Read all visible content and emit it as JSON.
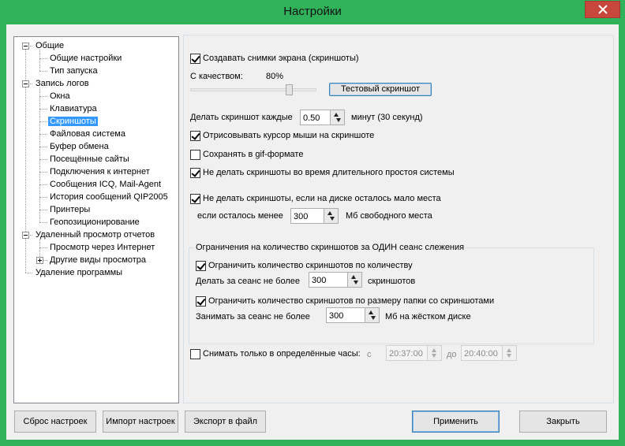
{
  "window": {
    "title": "Настройки"
  },
  "tree": {
    "items": [
      {
        "label": "Общие",
        "level": 0,
        "expander": "minus"
      },
      {
        "label": "Общие настройки",
        "level": 1
      },
      {
        "label": "Тип запуска",
        "level": 1
      },
      {
        "label": "Запись логов",
        "level": 0,
        "expander": "minus"
      },
      {
        "label": "Окна",
        "level": 1
      },
      {
        "label": "Клавиатура",
        "level": 1
      },
      {
        "label": "Скриншоты",
        "level": 1,
        "selected": true
      },
      {
        "label": "Файловая система",
        "level": 1
      },
      {
        "label": "Буфер обмена",
        "level": 1
      },
      {
        "label": "Посещённые сайты",
        "level": 1
      },
      {
        "label": "Подключения к интернет",
        "level": 1
      },
      {
        "label": "Сообщения ICQ, Mail-Agent",
        "level": 1
      },
      {
        "label": "История сообщений QIP2005",
        "level": 1
      },
      {
        "label": "Принтеры",
        "level": 1
      },
      {
        "label": "Геопозиционирование",
        "level": 1
      },
      {
        "label": "Удаленный просмотр отчетов",
        "level": 0,
        "expander": "minus"
      },
      {
        "label": "Просмотр через Интернет",
        "level": 1
      },
      {
        "label": "Другие виды просмотра",
        "level": 1,
        "expander": "plus"
      },
      {
        "label": "Удаление программы",
        "level": 0
      }
    ]
  },
  "screenshots": {
    "create_label": "Создавать снимки экрана (скриншоты)",
    "create_checked": true,
    "quality_label": "С качеством:",
    "quality_value": "80%",
    "quality_level": 0.8,
    "test_button": "Тестовый скриншот",
    "interval_label": "Делать скриншот каждые",
    "interval_value": "0.50",
    "interval_unit": "минут (30 секунд)",
    "draw_cursor_label": "Отрисовывать курсор мыши на скриншоте",
    "draw_cursor_checked": true,
    "gif_label": "Сохранять в gif-формате",
    "gif_checked": false,
    "idle_label": "Не делать скриншоты во время длительного простоя системы",
    "idle_checked": true,
    "lowdisk_label": "Не делать скриншоты, если на диске осталось мало места",
    "lowdisk_checked": true,
    "lowdisk_if_label": "если осталось менее",
    "lowdisk_value": "300",
    "lowdisk_unit": "Мб свободного места"
  },
  "limits": {
    "group_title": "Ограничения на количество скриншотов за ОДИН сеанс слежения",
    "by_count_label": "Ограничить количество скриншотов по количеству",
    "by_count_checked": true,
    "count_prefix": "Делать за сеанс не более",
    "count_value": "300",
    "count_unit": "скриншотов",
    "by_size_label": "Ограничить количество скриншотов по размеру папки со скриншотами",
    "by_size_checked": true,
    "size_prefix": "Занимать за сеанс не более",
    "size_value": "300",
    "size_unit": "Мб на жёстком диске"
  },
  "schedule": {
    "label": "Снимать только в определённые часы:",
    "checked": false,
    "from_label": "с",
    "from_value": "20:37:00",
    "to_label": "до",
    "to_value": "20:40:00"
  },
  "buttons": {
    "reset": "Сброс настроек",
    "import": "Импорт настроек",
    "export": "Экспорт в файл",
    "apply": "Применить",
    "close": "Закрыть"
  }
}
